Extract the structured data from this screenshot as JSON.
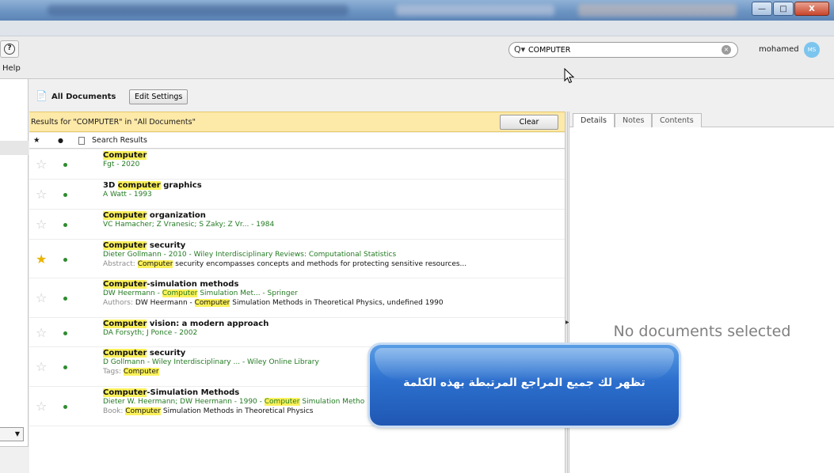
{
  "window": {
    "minimize_glyph": "—",
    "maximize_glyph": "□",
    "close_glyph": "X"
  },
  "toolbar": {
    "help_icon_glyph": "?",
    "help_label": "Help"
  },
  "search": {
    "icon_glyph": "Q▾",
    "value": "COMPUTER",
    "clear_glyph": "×"
  },
  "user": {
    "name": "mohamed",
    "initials": "MS"
  },
  "documents": {
    "title": "All Documents",
    "edit_settings_label": "Edit Settings",
    "results_text": "Results for \"COMPUTER\" in \"All Documents\"",
    "clear_label": "Clear"
  },
  "columns": {
    "star": "★",
    "dot": "●",
    "title": "Search Results"
  },
  "results": [
    {
      "starred": false,
      "title_parts": [
        {
          "t": "Computer",
          "hl": true
        }
      ],
      "meta_parts": [
        {
          "t": "Fgt - 2020",
          "hl": false
        }
      ],
      "extra_label": "",
      "extra_parts": []
    },
    {
      "starred": false,
      "title_parts": [
        {
          "t": "3D ",
          "hl": false
        },
        {
          "t": "computer",
          "hl": true
        },
        {
          "t": " graphics",
          "hl": false
        }
      ],
      "meta_parts": [
        {
          "t": "A Watt - 1993",
          "hl": false
        }
      ],
      "extra_label": "",
      "extra_parts": []
    },
    {
      "starred": false,
      "title_parts": [
        {
          "t": "Computer",
          "hl": true
        },
        {
          "t": " organization",
          "hl": false
        }
      ],
      "meta_parts": [
        {
          "t": "VC Hamacher; Z Vranesic; S Zaky; Z Vr... - 1984",
          "hl": false
        }
      ],
      "extra_label": "",
      "extra_parts": []
    },
    {
      "starred": true,
      "title_parts": [
        {
          "t": "Computer",
          "hl": true
        },
        {
          "t": " security",
          "hl": false
        }
      ],
      "meta_parts": [
        {
          "t": "Dieter Gollmann - 2010 - Wiley Interdisciplinary Reviews: Computational Statistics",
          "hl": false
        }
      ],
      "extra_label": "Abstract: ",
      "extra_parts": [
        {
          "t": "Computer",
          "hl": true
        },
        {
          "t": " security encompasses concepts and methods for protecting sensitive resources...",
          "hl": false
        }
      ]
    },
    {
      "starred": false,
      "title_parts": [
        {
          "t": "Computer",
          "hl": true
        },
        {
          "t": "-simulation methods",
          "hl": false
        }
      ],
      "meta_parts": [
        {
          "t": "DW Heermann - ",
          "hl": false
        },
        {
          "t": "Computer",
          "hl": true
        },
        {
          "t": " Simulation Met... - Springer",
          "hl": false
        }
      ],
      "extra_label": "Authors: ",
      "extra_parts": [
        {
          "t": "DW Heermann - ",
          "hl": false
        },
        {
          "t": "Computer",
          "hl": true
        },
        {
          "t": " Simulation Methods in Theoretical Physics, undefined 1990",
          "hl": false
        }
      ]
    },
    {
      "starred": false,
      "title_parts": [
        {
          "t": "Computer",
          "hl": true
        },
        {
          "t": " vision: a modern approach",
          "hl": false
        }
      ],
      "meta_parts": [
        {
          "t": "DA Forsyth; J Ponce - 2002",
          "hl": false
        }
      ],
      "extra_label": "",
      "extra_parts": []
    },
    {
      "starred": false,
      "title_parts": [
        {
          "t": "Computer",
          "hl": true
        },
        {
          "t": " security",
          "hl": false
        }
      ],
      "meta_parts": [
        {
          "t": "D Gollmann - Wiley Interdisciplinary ... - Wiley Online Library",
          "hl": false
        }
      ],
      "extra_label": "Tags: ",
      "extra_parts": [
        {
          "t": "Computer",
          "hl": true
        }
      ]
    },
    {
      "starred": false,
      "title_parts": [
        {
          "t": "Computer",
          "hl": true
        },
        {
          "t": "-Simulation Methods",
          "hl": false
        }
      ],
      "meta_parts": [
        {
          "t": "Dieter W. Heermann; DW Heermann - 1990 - ",
          "hl": false
        },
        {
          "t": "Computer",
          "hl": true
        },
        {
          "t": " Simulation Metho",
          "hl": false
        }
      ],
      "extra_label": "Book: ",
      "extra_parts": [
        {
          "t": "Computer",
          "hl": true
        },
        {
          "t": " Simulation Methods in Theoretical Physics",
          "hl": false
        }
      ]
    }
  ],
  "details_panel": {
    "tabs": [
      "Details",
      "Notes",
      "Contents"
    ],
    "empty_message": "No documents selected"
  },
  "callout": {
    "text": "تظهر لك جميع المراجع المرتبطة بهذه الكلمة"
  },
  "colors": {
    "highlight": "#fbf15a",
    "banner": "#fde9a8",
    "meta_green": "#237a23",
    "callout_blue": "#2c6fcd"
  }
}
